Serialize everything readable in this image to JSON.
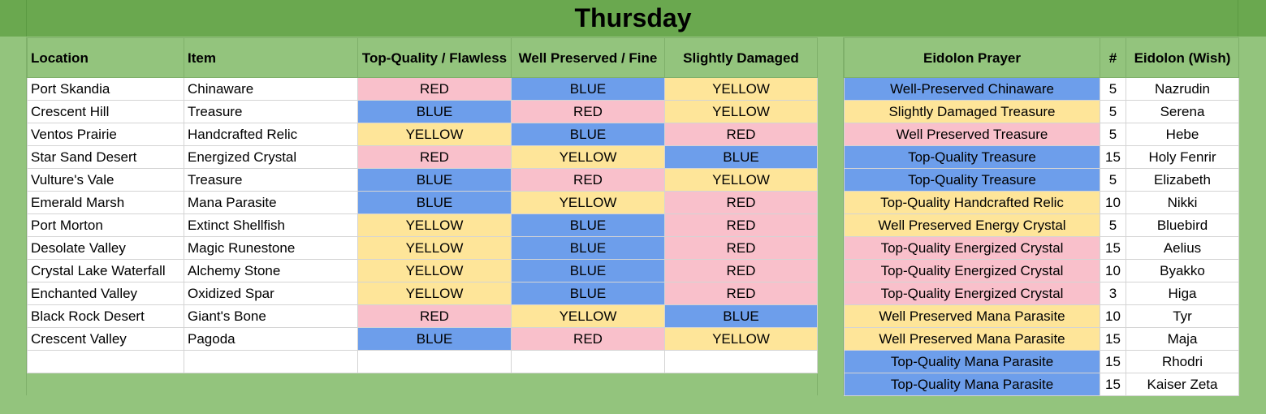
{
  "title": "Thursday",
  "left_headers": [
    "Location",
    "Item",
    "Top-Quality / Flawless",
    "Well Preserved / Fine",
    "Slightly Damaged"
  ],
  "left_rows": [
    {
      "location": "Port Skandia",
      "item": "Chinaware",
      "top": "RED",
      "well": "BLUE",
      "slight": "YELLOW"
    },
    {
      "location": "Crescent Hill",
      "item": "Treasure",
      "top": "BLUE",
      "well": "RED",
      "slight": "YELLOW"
    },
    {
      "location": "Ventos Prairie",
      "item": "Handcrafted Relic",
      "top": "YELLOW",
      "well": "BLUE",
      "slight": "RED"
    },
    {
      "location": "Star Sand Desert",
      "item": "Energized Crystal",
      "top": "RED",
      "well": "YELLOW",
      "slight": "BLUE"
    },
    {
      "location": "Vulture's Vale",
      "item": "Treasure",
      "top": "BLUE",
      "well": "RED",
      "slight": "YELLOW"
    },
    {
      "location": "Emerald Marsh",
      "item": "Mana Parasite",
      "top": "BLUE",
      "well": "YELLOW",
      "slight": "RED"
    },
    {
      "location": "Port Morton",
      "item": "Extinct Shellfish",
      "top": "YELLOW",
      "well": "BLUE",
      "slight": "RED"
    },
    {
      "location": "Desolate Valley",
      "item": "Magic Runestone",
      "top": "YELLOW",
      "well": "BLUE",
      "slight": "RED"
    },
    {
      "location": "Crystal Lake Waterfall",
      "item": "Alchemy Stone",
      "top": "YELLOW",
      "well": "BLUE",
      "slight": "RED"
    },
    {
      "location": "Enchanted Valley",
      "item": "Oxidized Spar",
      "top": "YELLOW",
      "well": "BLUE",
      "slight": "RED"
    },
    {
      "location": "Black Rock Desert",
      "item": "Giant's Bone",
      "top": "RED",
      "well": "YELLOW",
      "slight": "BLUE"
    },
    {
      "location": "Crescent Valley",
      "item": "Pagoda",
      "top": "BLUE",
      "well": "RED",
      "slight": "YELLOW"
    }
  ],
  "right_headers": [
    "Eidolon Prayer",
    "#",
    "Eidolon (Wish)"
  ],
  "right_rows": [
    {
      "prayer": "Well-Preserved Chinaware",
      "color": "BLUE",
      "count": "5",
      "eidolon": "Nazrudin"
    },
    {
      "prayer": "Slightly Damaged Treasure",
      "color": "YELLOW",
      "count": "5",
      "eidolon": "Serena"
    },
    {
      "prayer": "Well Preserved Treasure",
      "color": "RED",
      "count": "5",
      "eidolon": "Hebe"
    },
    {
      "prayer": "Top-Quality Treasure",
      "color": "BLUE",
      "count": "15",
      "eidolon": "Holy Fenrir"
    },
    {
      "prayer": "Top-Quality Treasure",
      "color": "BLUE",
      "count": "5",
      "eidolon": "Elizabeth"
    },
    {
      "prayer": "Top-Quality Handcrafted Relic",
      "color": "YELLOW",
      "count": "10",
      "eidolon": "Nikki"
    },
    {
      "prayer": "Well Preserved Energy Crystal",
      "color": "YELLOW",
      "count": "5",
      "eidolon": "Bluebird"
    },
    {
      "prayer": "Top-Quality Energized Crystal",
      "color": "RED",
      "count": "15",
      "eidolon": "Aelius"
    },
    {
      "prayer": "Top-Quality Energized Crystal",
      "color": "RED",
      "count": "10",
      "eidolon": "Byakko"
    },
    {
      "prayer": "Top-Quality Energized Crystal",
      "color": "RED",
      "count": "3",
      "eidolon": "Higa"
    },
    {
      "prayer": "Well Preserved Mana Parasite",
      "color": "YELLOW",
      "count": "10",
      "eidolon": "Tyr"
    },
    {
      "prayer": "Well Preserved Mana Parasite",
      "color": "YELLOW",
      "count": "15",
      "eidolon": "Maja"
    },
    {
      "prayer": "Top-Quality Mana Parasite",
      "color": "BLUE",
      "count": "15",
      "eidolon": "Rhodri"
    },
    {
      "prayer": "Top-Quality Mana Parasite",
      "color": "BLUE",
      "count": "15",
      "eidolon": "Kaiser Zeta"
    }
  ],
  "colors": {
    "RED": "#f9c0cb",
    "BLUE": "#6d9eeb",
    "YELLOW": "#fee599",
    "header": "#93c47d",
    "title_bar": "#6aa84f"
  }
}
